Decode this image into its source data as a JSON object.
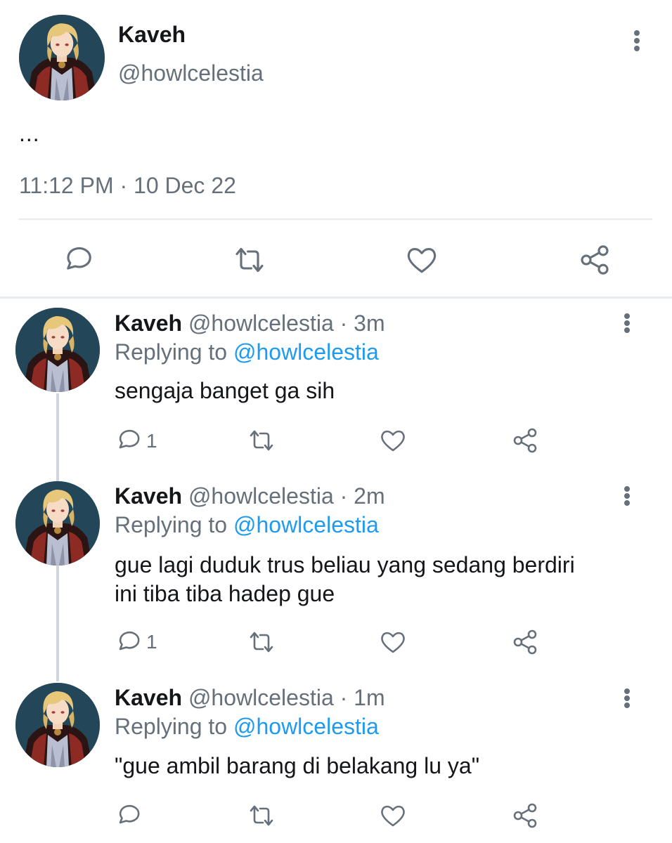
{
  "main_tweet": {
    "name": "Kaveh",
    "handle": "@howlcelestia",
    "text": "...",
    "timestamp": "11:12 PM · 10 Dec 22"
  },
  "replies": [
    {
      "name": "Kaveh",
      "meta": "@howlcelestia · 3m",
      "replying_prefix": "Replying to",
      "replying_handle": "@howlcelestia",
      "text_lines": [
        "sengaja banget ga sih"
      ],
      "reply_count": "1"
    },
    {
      "name": "Kaveh",
      "meta": "@howlcelestia · 2m",
      "replying_prefix": "Replying to",
      "replying_handle": "@howlcelestia",
      "text_lines": [
        "gue lagi duduk trus beliau yang sedang berdiri",
        "ini tiba tiba hadep gue"
      ],
      "reply_count": "1"
    },
    {
      "name": "Kaveh",
      "meta": "@howlcelestia · 1m",
      "replying_prefix": "Replying to",
      "replying_handle": "@howlcelestia",
      "text_lines": [
        "\"gue ambil barang di belakang lu ya\""
      ],
      "reply_count": ""
    }
  ],
  "icons": {
    "reply": "speech-bubble-icon",
    "retweet": "retweet-icon",
    "like": "heart-icon",
    "share": "share-icon",
    "menu": "more-vertical-icon"
  },
  "colors": {
    "link": "#1d9bf0",
    "muted": "#66707a",
    "divider": "#e7eaed"
  }
}
